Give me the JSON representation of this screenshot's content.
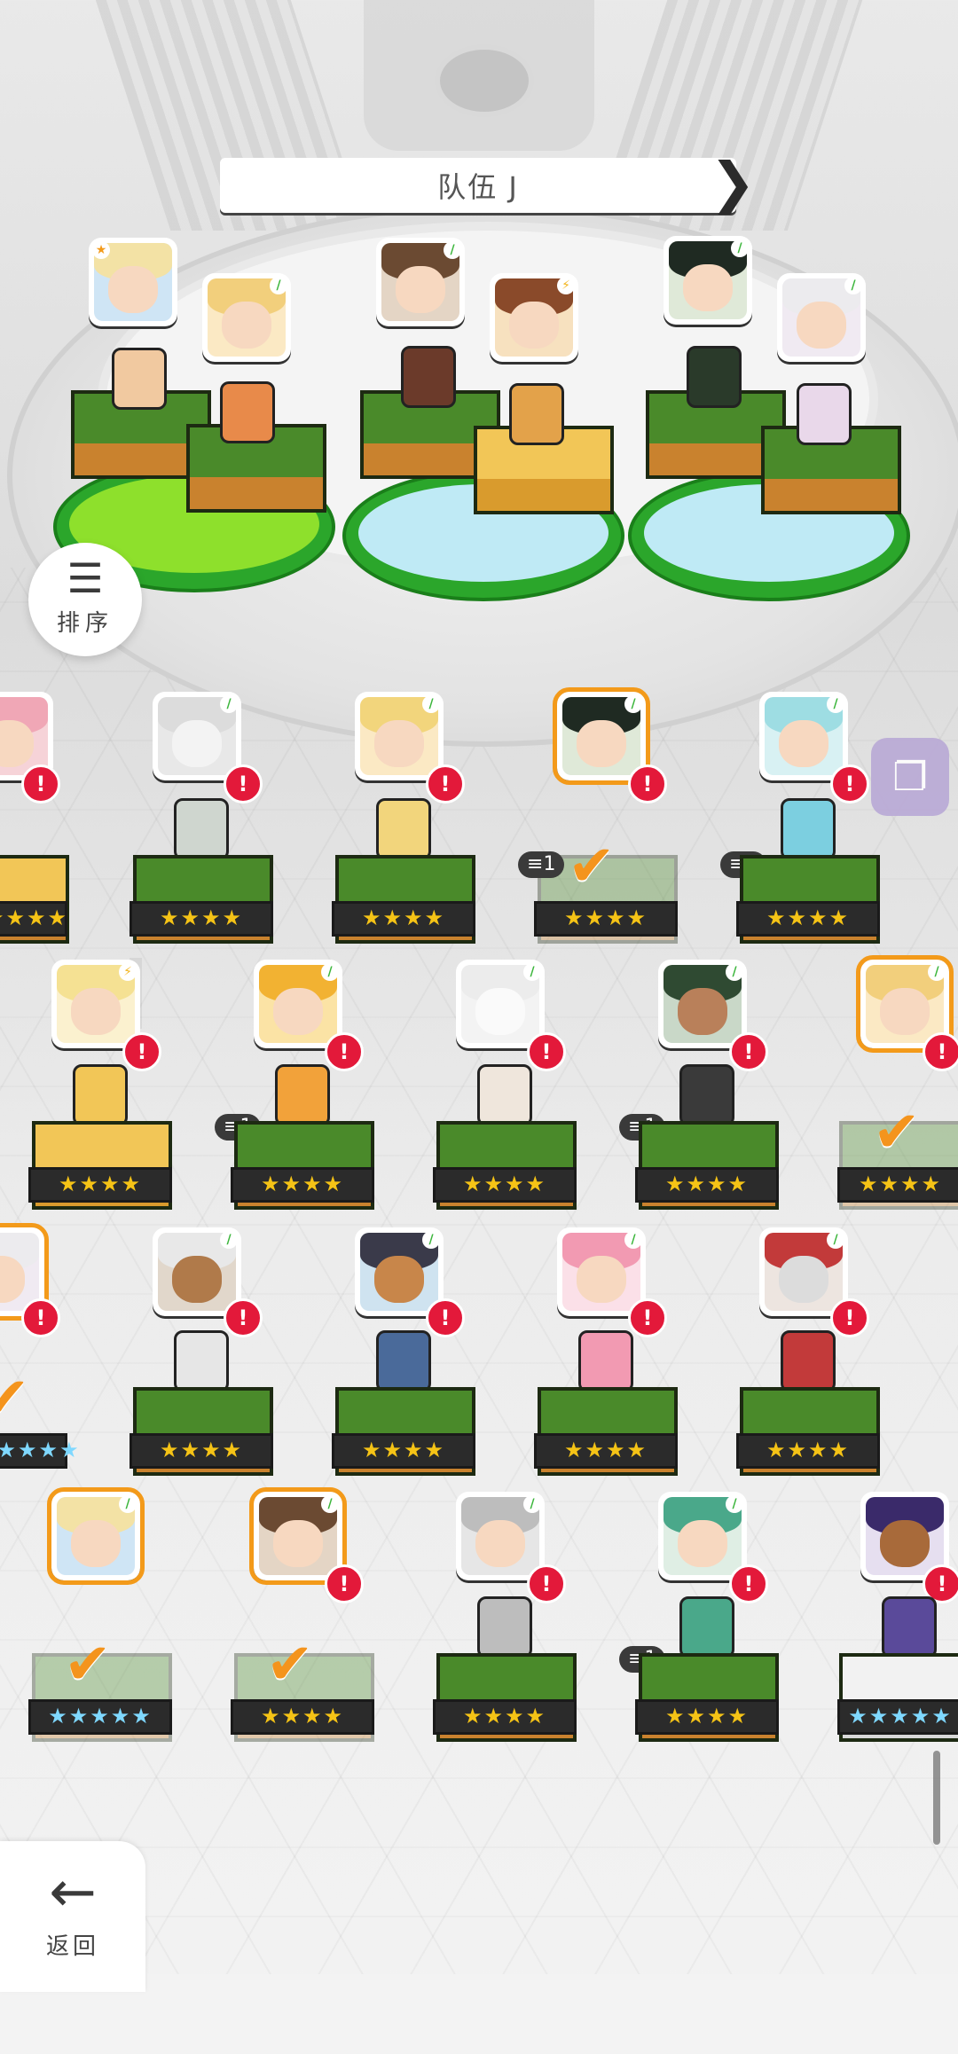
{
  "header": {
    "team_name": "队伍 J",
    "prev_arrow": "❮",
    "next_arrow": "❯"
  },
  "sort_button": {
    "label": "排序",
    "icon": "sort-lines-icon"
  },
  "back_button": {
    "label": "返回",
    "icon": "back-arrow-icon"
  },
  "switch_button": {
    "icon": "window-switch-icon"
  },
  "colors": {
    "selected_outline": "#f39a1a",
    "alert": "#e3193a",
    "grass": "#4a8a2a",
    "star": "#f5c316"
  },
  "roster": {
    "row1_counts": [
      "1",
      "1"
    ],
    "row2_counts": [
      "1",
      "1"
    ],
    "row4_counts": [
      "1"
    ],
    "stars4": "★★★★",
    "stars5": "★★★★★",
    "alert_mark": "!",
    "check_mark": "✔"
  }
}
